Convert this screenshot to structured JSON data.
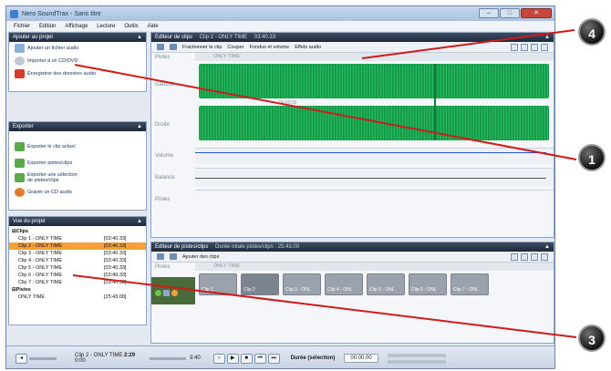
{
  "window": {
    "title": "Nero SoundTrax - Sans titre"
  },
  "menu": [
    "Fichier",
    "Edition",
    "Affichage",
    "Lecture",
    "Outils",
    "Aide"
  ],
  "panels": {
    "add": {
      "title": "Ajouter au projet",
      "items": [
        "Ajouter un fichier audio",
        "Importer à un CD/DVD",
        "Enregistrer des données audio"
      ]
    },
    "export": {
      "title": "Exporter",
      "items": [
        "Exporter le clip actuel",
        "Exporter pistes/clips",
        "Exporter une sélection de pistes/clips",
        "Graver un CD audio"
      ]
    },
    "project": {
      "title": "Vue du projet",
      "clips_group": "Clips",
      "clips": [
        {
          "name": "Clip 1 - ONLY TIME",
          "dur": "[03:40.33]"
        },
        {
          "name": "Clip 2 - ONLY TIME",
          "dur": "[03:40.33]"
        },
        {
          "name": "Clip 3 - ONLY TIME",
          "dur": "[03:40.33]"
        },
        {
          "name": "Clip 4 - ONLY TIME",
          "dur": "[03:40.33]"
        },
        {
          "name": "Clip 5 - ONLY TIME",
          "dur": "[03:40.33]"
        },
        {
          "name": "Clip 6 - ONLY TIME",
          "dur": "[03:40.33]"
        },
        {
          "name": "Clip 7 - ONLY TIME",
          "dur": "[03:40.33]"
        }
      ],
      "tracks_group": "Pistes",
      "tracks": [
        {
          "name": "ONLY TIME",
          "dur": "[25:43.00]"
        }
      ]
    }
  },
  "clip_editor": {
    "title": "Editeur de clips",
    "subtitle": "Clip 2 - ONLY TIME",
    "time": "03:40.33",
    "tools": [
      "Fractionner le clip",
      "Couper",
      "Fondus et volume",
      "Effets audio"
    ],
    "labels": [
      "Pistes",
      "Gauche",
      "Droite",
      "Volume",
      "Balance",
      "Pistes"
    ],
    "ruler_text": "ONLY TIME",
    "waveform_time": "00:00:00"
  },
  "track_editor": {
    "title": "Editeur de pistes/clips",
    "subtitle": "Durée totale pistes/clips : 25:43.00",
    "tool": "Ajouter des clips",
    "label": "Pistes",
    "ruler_text": "ONLY TIME",
    "clip_labels": [
      "Clip 1",
      "Clip 2",
      "Clip 3 - ONL",
      "Clip 4 - ONL",
      "Clip 5 - ONL",
      "Clip 6 - ONL",
      "Clip 7 - ONL"
    ]
  },
  "transport": {
    "clip_name": "Clip 2 - ONLY TIME",
    "clip_time": "2:29",
    "position": "0:00",
    "length": "3:40",
    "selection_label": "Durée (sélection)",
    "selection_value": "00:00.00"
  },
  "callouts": [
    "4",
    "1",
    "3"
  ],
  "colors": {
    "waveform": "#1fa855",
    "panel_header": "#2a374b",
    "selected": "#f3a03a",
    "callout_line": "#d11a1a"
  }
}
